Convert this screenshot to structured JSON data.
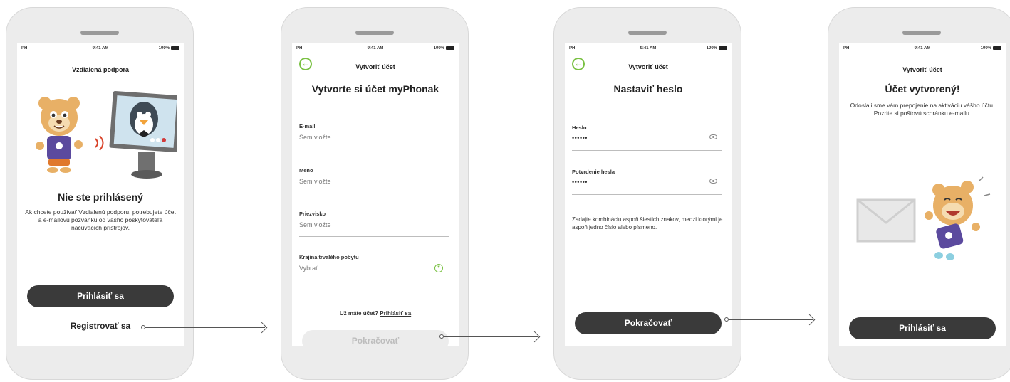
{
  "status": {
    "carrier": "PH",
    "time": "9:41 AM",
    "battery": "100%"
  },
  "screen1": {
    "header": "Vzdialená podpora",
    "title": "Nie ste prihlásený",
    "body": "Ak chcete používať Vzdialenú podporu, potrebujete účet a e-mailovú pozvánku od vášho poskytovateľa načúvacích prístrojov.",
    "login_button": "Prihlásiť sa",
    "register_link": "Registrovať sa"
  },
  "screen2": {
    "header": "Vytvoriť účet",
    "title": "Vytvorte si účet myPhonak",
    "fields": [
      {
        "label": "E-mail",
        "placeholder": "Sem vložte"
      },
      {
        "label": "Meno",
        "placeholder": "Sem vložte"
      },
      {
        "label": "Priezvisko",
        "placeholder": "Sem vložte"
      },
      {
        "label": "Krajina trvalého pobytu",
        "placeholder": "Vybrať"
      }
    ],
    "have_account": "Už máte účet?",
    "login_link": "Prihlásiť sa",
    "continue_button": "Pokračovať"
  },
  "screen3": {
    "header": "Vytvoriť účet",
    "title": "Nastaviť heslo",
    "fields": [
      {
        "label": "Heslo",
        "value": "••••••"
      },
      {
        "label": "Potvrdenie hesla",
        "value": "••••••"
      }
    ],
    "hint": "Zadajte kombináciu aspoň šiestich znakov, medzi ktorými je aspoň jedno číslo alebo písmeno.",
    "continue_button": "Pokračovať"
  },
  "screen4": {
    "header": "Vytvoriť účet",
    "title": "Účet vytvorený!",
    "body": "Odoslali sme vám prepojenie na aktiváciu vášho účtu. Pozrite si poštovú schránku e-mailu.",
    "login_button": "Prihlásiť sa"
  },
  "colors": {
    "accent": "#7ac143",
    "button": "#3a3a3a",
    "phone_frame": "#ececec"
  }
}
